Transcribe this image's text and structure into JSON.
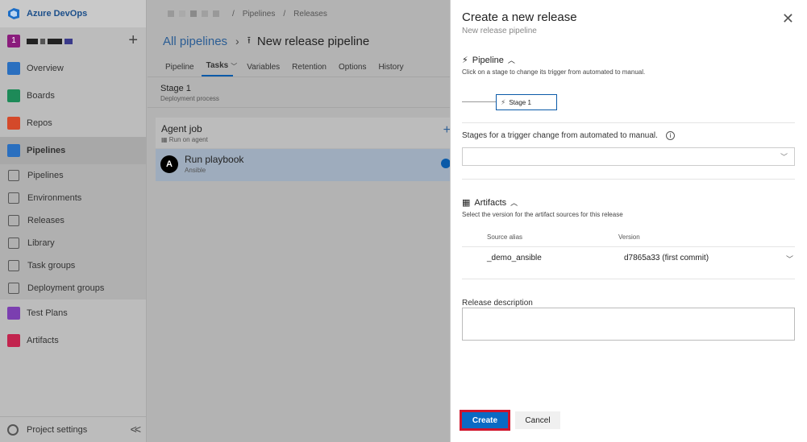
{
  "nav": {
    "brand": "Azure DevOps",
    "project_initial": "1",
    "items": [
      {
        "label": "Overview",
        "icon": "overview-icon",
        "color": "#2a6fbf"
      },
      {
        "label": "Boards",
        "icon": "boards-icon",
        "color": "#1d8a58"
      },
      {
        "label": "Repos",
        "icon": "repos-icon",
        "color": "#d4492a"
      },
      {
        "label": "Pipelines",
        "icon": "pipelines-icon",
        "color": "#2a6fbf"
      }
    ],
    "sub_items": [
      {
        "label": "Pipelines",
        "icon": "pipelines-sub-icon"
      },
      {
        "label": "Environments",
        "icon": "environments-icon"
      },
      {
        "label": "Releases",
        "icon": "releases-icon"
      },
      {
        "label": "Library",
        "icon": "library-icon"
      },
      {
        "label": "Task groups",
        "icon": "task-groups-icon"
      },
      {
        "label": "Deployment groups",
        "icon": "deployment-groups-icon"
      }
    ],
    "items_after": [
      {
        "label": "Test Plans",
        "icon": "test-plans-icon",
        "color": "#7b3fb0"
      },
      {
        "label": "Artifacts",
        "icon": "artifacts-icon",
        "color": "#c2244e"
      }
    ],
    "settings": "Project settings"
  },
  "breadcrumb": {
    "items": [
      "Pipelines",
      "Releases"
    ]
  },
  "header": {
    "all_pipelines": "All pipelines",
    "pipeline_name": "New release pipeline"
  },
  "tabs": [
    "Pipeline",
    "Tasks",
    "Variables",
    "Retention",
    "Options",
    "History"
  ],
  "stage": {
    "title": "Stage 1",
    "subtitle": "Deployment process"
  },
  "agent_job": {
    "title": "Agent job",
    "subtitle": "Run on agent"
  },
  "task": {
    "title": "Run playbook",
    "subtitle": "Ansible",
    "logo": "A"
  },
  "dialog": {
    "title": "Create a new release",
    "subtitle": "New release pipeline",
    "pipeline_section": {
      "title": "Pipeline",
      "description": "Click on a stage to change its trigger from automated to manual.",
      "stage_label": "Stage 1"
    },
    "trigger_label": "Stages for a trigger change from automated to manual.",
    "trigger_value": "",
    "artifacts_section": {
      "title": "Artifacts",
      "description": "Select the version for the artifact sources for this release",
      "col_source": "Source alias",
      "col_version": "Version",
      "rows": [
        {
          "source": "_demo_ansible",
          "version": "d7865a33 (first commit)"
        }
      ]
    },
    "release_description_label": "Release description",
    "release_description_value": "",
    "create_label": "Create",
    "cancel_label": "Cancel"
  }
}
